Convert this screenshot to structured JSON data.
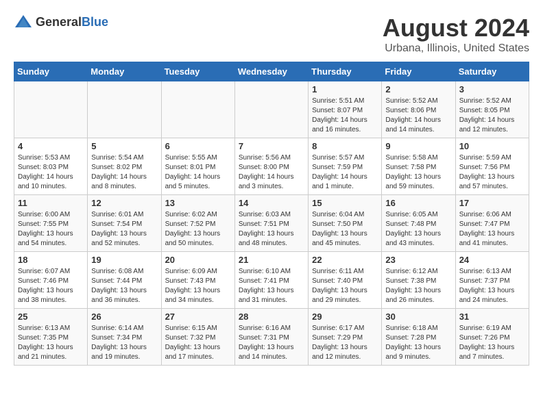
{
  "app": {
    "logo_general": "General",
    "logo_blue": "Blue"
  },
  "header": {
    "title": "August 2024",
    "subtitle": "Urbana, Illinois, United States"
  },
  "calendar": {
    "days_of_week": [
      "Sunday",
      "Monday",
      "Tuesday",
      "Wednesday",
      "Thursday",
      "Friday",
      "Saturday"
    ],
    "weeks": [
      {
        "cells": [
          {
            "day": "",
            "empty": true
          },
          {
            "day": "",
            "empty": true
          },
          {
            "day": "",
            "empty": true
          },
          {
            "day": "",
            "empty": true
          },
          {
            "day": "1",
            "sunrise": "Sunrise: 5:51 AM",
            "sunset": "Sunset: 8:07 PM",
            "daylight": "Daylight: 14 hours and 16 minutes."
          },
          {
            "day": "2",
            "sunrise": "Sunrise: 5:52 AM",
            "sunset": "Sunset: 8:06 PM",
            "daylight": "Daylight: 14 hours and 14 minutes."
          },
          {
            "day": "3",
            "sunrise": "Sunrise: 5:52 AM",
            "sunset": "Sunset: 8:05 PM",
            "daylight": "Daylight: 14 hours and 12 minutes."
          }
        ]
      },
      {
        "cells": [
          {
            "day": "4",
            "sunrise": "Sunrise: 5:53 AM",
            "sunset": "Sunset: 8:03 PM",
            "daylight": "Daylight: 14 hours and 10 minutes."
          },
          {
            "day": "5",
            "sunrise": "Sunrise: 5:54 AM",
            "sunset": "Sunset: 8:02 PM",
            "daylight": "Daylight: 14 hours and 8 minutes."
          },
          {
            "day": "6",
            "sunrise": "Sunrise: 5:55 AM",
            "sunset": "Sunset: 8:01 PM",
            "daylight": "Daylight: 14 hours and 5 minutes."
          },
          {
            "day": "7",
            "sunrise": "Sunrise: 5:56 AM",
            "sunset": "Sunset: 8:00 PM",
            "daylight": "Daylight: 14 hours and 3 minutes."
          },
          {
            "day": "8",
            "sunrise": "Sunrise: 5:57 AM",
            "sunset": "Sunset: 7:59 PM",
            "daylight": "Daylight: 14 hours and 1 minute."
          },
          {
            "day": "9",
            "sunrise": "Sunrise: 5:58 AM",
            "sunset": "Sunset: 7:58 PM",
            "daylight": "Daylight: 13 hours and 59 minutes."
          },
          {
            "day": "10",
            "sunrise": "Sunrise: 5:59 AM",
            "sunset": "Sunset: 7:56 PM",
            "daylight": "Daylight: 13 hours and 57 minutes."
          }
        ]
      },
      {
        "cells": [
          {
            "day": "11",
            "sunrise": "Sunrise: 6:00 AM",
            "sunset": "Sunset: 7:55 PM",
            "daylight": "Daylight: 13 hours and 54 minutes."
          },
          {
            "day": "12",
            "sunrise": "Sunrise: 6:01 AM",
            "sunset": "Sunset: 7:54 PM",
            "daylight": "Daylight: 13 hours and 52 minutes."
          },
          {
            "day": "13",
            "sunrise": "Sunrise: 6:02 AM",
            "sunset": "Sunset: 7:52 PM",
            "daylight": "Daylight: 13 hours and 50 minutes."
          },
          {
            "day": "14",
            "sunrise": "Sunrise: 6:03 AM",
            "sunset": "Sunset: 7:51 PM",
            "daylight": "Daylight: 13 hours and 48 minutes."
          },
          {
            "day": "15",
            "sunrise": "Sunrise: 6:04 AM",
            "sunset": "Sunset: 7:50 PM",
            "daylight": "Daylight: 13 hours and 45 minutes."
          },
          {
            "day": "16",
            "sunrise": "Sunrise: 6:05 AM",
            "sunset": "Sunset: 7:48 PM",
            "daylight": "Daylight: 13 hours and 43 minutes."
          },
          {
            "day": "17",
            "sunrise": "Sunrise: 6:06 AM",
            "sunset": "Sunset: 7:47 PM",
            "daylight": "Daylight: 13 hours and 41 minutes."
          }
        ]
      },
      {
        "cells": [
          {
            "day": "18",
            "sunrise": "Sunrise: 6:07 AM",
            "sunset": "Sunset: 7:46 PM",
            "daylight": "Daylight: 13 hours and 38 minutes."
          },
          {
            "day": "19",
            "sunrise": "Sunrise: 6:08 AM",
            "sunset": "Sunset: 7:44 PM",
            "daylight": "Daylight: 13 hours and 36 minutes."
          },
          {
            "day": "20",
            "sunrise": "Sunrise: 6:09 AM",
            "sunset": "Sunset: 7:43 PM",
            "daylight": "Daylight: 13 hours and 34 minutes."
          },
          {
            "day": "21",
            "sunrise": "Sunrise: 6:10 AM",
            "sunset": "Sunset: 7:41 PM",
            "daylight": "Daylight: 13 hours and 31 minutes."
          },
          {
            "day": "22",
            "sunrise": "Sunrise: 6:11 AM",
            "sunset": "Sunset: 7:40 PM",
            "daylight": "Daylight: 13 hours and 29 minutes."
          },
          {
            "day": "23",
            "sunrise": "Sunrise: 6:12 AM",
            "sunset": "Sunset: 7:38 PM",
            "daylight": "Daylight: 13 hours and 26 minutes."
          },
          {
            "day": "24",
            "sunrise": "Sunrise: 6:13 AM",
            "sunset": "Sunset: 7:37 PM",
            "daylight": "Daylight: 13 hours and 24 minutes."
          }
        ]
      },
      {
        "cells": [
          {
            "day": "25",
            "sunrise": "Sunrise: 6:13 AM",
            "sunset": "Sunset: 7:35 PM",
            "daylight": "Daylight: 13 hours and 21 minutes."
          },
          {
            "day": "26",
            "sunrise": "Sunrise: 6:14 AM",
            "sunset": "Sunset: 7:34 PM",
            "daylight": "Daylight: 13 hours and 19 minutes."
          },
          {
            "day": "27",
            "sunrise": "Sunrise: 6:15 AM",
            "sunset": "Sunset: 7:32 PM",
            "daylight": "Daylight: 13 hours and 17 minutes."
          },
          {
            "day": "28",
            "sunrise": "Sunrise: 6:16 AM",
            "sunset": "Sunset: 7:31 PM",
            "daylight": "Daylight: 13 hours and 14 minutes."
          },
          {
            "day": "29",
            "sunrise": "Sunrise: 6:17 AM",
            "sunset": "Sunset: 7:29 PM",
            "daylight": "Daylight: 13 hours and 12 minutes."
          },
          {
            "day": "30",
            "sunrise": "Sunrise: 6:18 AM",
            "sunset": "Sunset: 7:28 PM",
            "daylight": "Daylight: 13 hours and 9 minutes."
          },
          {
            "day": "31",
            "sunrise": "Sunrise: 6:19 AM",
            "sunset": "Sunset: 7:26 PM",
            "daylight": "Daylight: 13 hours and 7 minutes."
          }
        ]
      }
    ]
  }
}
